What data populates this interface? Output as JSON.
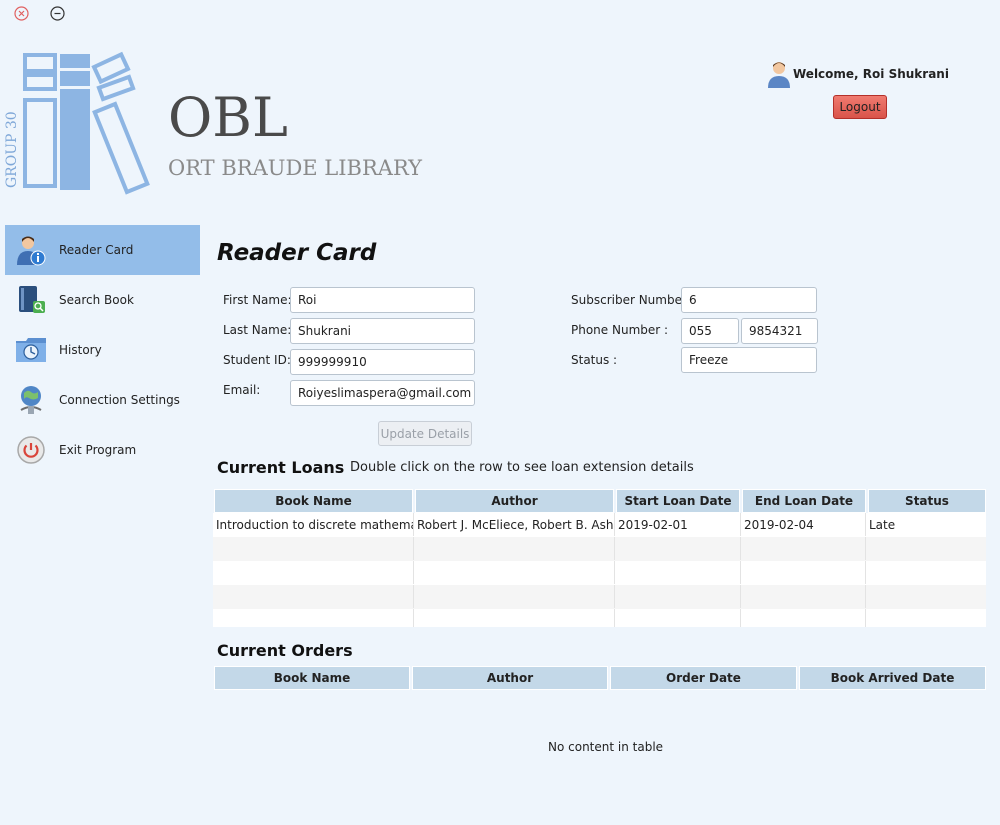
{
  "window": {
    "close_icon": "circle-x-icon",
    "minimize_icon": "circle-minus-icon"
  },
  "logo": {
    "title": "OBL",
    "subtitle": "ORT BRAUDE LIBRARY",
    "group_label": "GROUP 30",
    "accent_color": "#7ea7d8"
  },
  "user": {
    "welcome": "Welcome, Roi Shukrani",
    "logout_label": "Logout"
  },
  "sidebar": {
    "items": [
      {
        "label": "Reader Card",
        "icon": "reader-card-icon",
        "active": true
      },
      {
        "label": "Search Book",
        "icon": "search-book-icon",
        "active": false
      },
      {
        "label": "History",
        "icon": "history-clock-icon",
        "active": false
      },
      {
        "label": "Connection Settings",
        "icon": "connection-globe-icon",
        "active": false
      },
      {
        "label": "Exit Program",
        "icon": "power-icon",
        "active": false
      }
    ],
    "active_color": "#93bde9"
  },
  "reader_card": {
    "heading": "Reader Card",
    "first_name_label": "First Name:",
    "first_name_value": "Roi",
    "last_name_label": "Last Name:",
    "last_name_value": "Shukrani",
    "student_id_label": "Student ID:",
    "student_id_value": "999999910",
    "email_label": "Email:",
    "email_value": "Roiyeslimaspera@gmail.com",
    "subscriber_number_label": "Subscriber Number:",
    "subscriber_number_value": "6",
    "phone_label": "Phone Number :",
    "phone_prefix_value": "055",
    "phone_number_value": "9854321",
    "status_label": "Status :",
    "status_value": "Freeze",
    "update_button": "Update Details"
  },
  "loans": {
    "title": "Current Loans",
    "hint": "Double click on the row to see loan extension details",
    "columns": [
      "Book Name",
      "Author",
      "Start Loan Date",
      "End Loan Date",
      "Status"
    ],
    "rows": [
      [
        "Introduction to discrete mathemati...",
        "Robert J. McEliece, Robert B. Ash, ...",
        "2019-02-01",
        "2019-02-04",
        "Late"
      ]
    ]
  },
  "orders": {
    "title": "Current Orders",
    "columns": [
      "Book Name",
      "Author",
      "Order Date",
      "Book Arrived Date"
    ],
    "empty_message": "No content in table"
  }
}
